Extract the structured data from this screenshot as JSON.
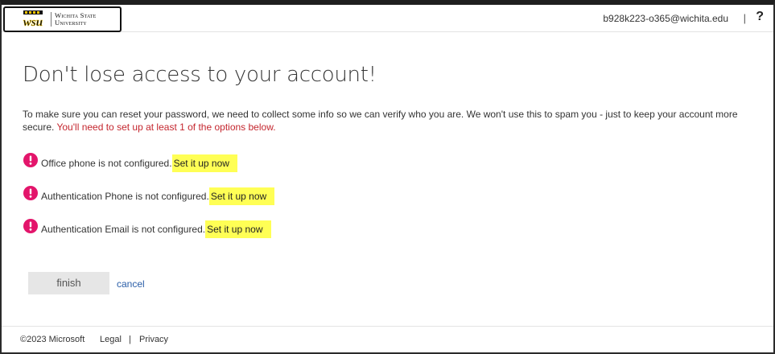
{
  "header": {
    "logo_line1": "Wichita State",
    "logo_line2": "University",
    "user_email": "b928k223-o365@wichita.edu",
    "separator": "|",
    "help": "?"
  },
  "main": {
    "title": "Don't lose access to your account!",
    "intro": "To make sure you can reset your password, we need to collect some info so we can verify who you are. We won't use this to spam you - just to keep your account more secure.",
    "intro_warning": "You'll need to set up at least 1 of the options below.",
    "items": [
      {
        "text": "Office phone is not configured.",
        "link": "Set it up now"
      },
      {
        "text": "Authentication Phone is not configured.",
        "link": "Set it up now"
      },
      {
        "text": "Authentication Email is not configured.",
        "link": "Set it up now"
      }
    ],
    "finish_label": "finish",
    "cancel_label": "cancel"
  },
  "footer": {
    "copyright": "©2023 Microsoft",
    "legal": "Legal",
    "separator": "|",
    "privacy": "Privacy"
  },
  "colors": {
    "warning_red": "#c4262e",
    "alert_pink": "#e3156b",
    "highlight_yellow": "#ffff55",
    "link_blue": "#2a5ea8"
  }
}
